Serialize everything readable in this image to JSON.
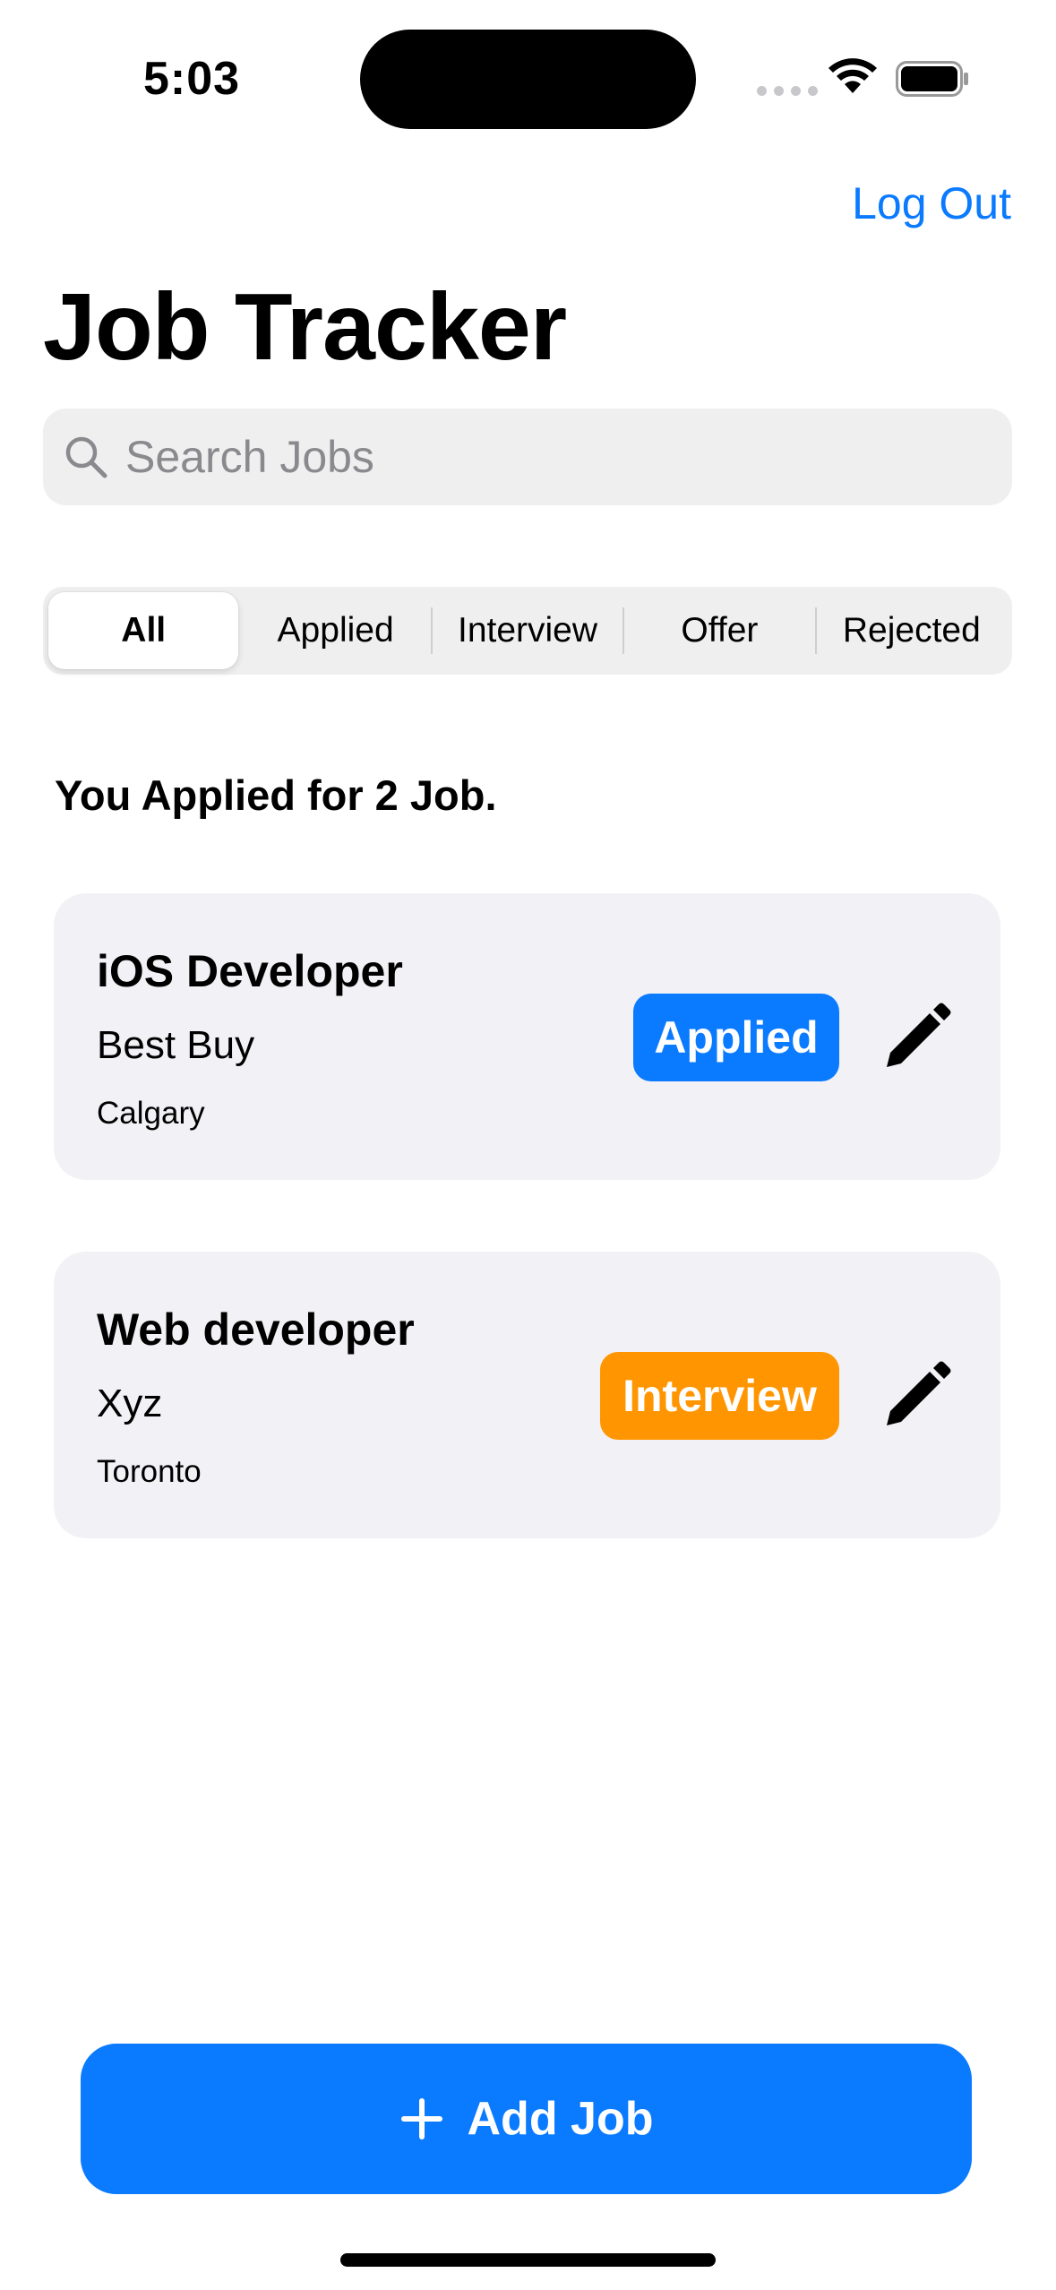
{
  "status_bar": {
    "time": "5:03"
  },
  "nav": {
    "logout_label": "Log Out",
    "title": "Job Tracker"
  },
  "search": {
    "placeholder": "Search Jobs",
    "value": ""
  },
  "filters": {
    "selected": "All",
    "segments": [
      "All",
      "Applied",
      "Interview",
      "Offer",
      "Rejected"
    ]
  },
  "summary": "You Applied for 2 Job.",
  "jobs": [
    {
      "title": "iOS Developer",
      "company": "Best Buy",
      "location": "Calgary",
      "status": "Applied",
      "status_color": "#0A7AFF"
    },
    {
      "title": "Web developer",
      "company": "Xyz",
      "location": "Toronto",
      "status": "Interview",
      "status_color": "#FF9500"
    }
  ],
  "add_button": {
    "label": "Add Job",
    "icon": "plus-icon"
  },
  "colors": {
    "accent": "#0A7AFF",
    "interview": "#FF9500",
    "card_bg": "#F2F2F6",
    "field_bg": "#EFEFF0"
  }
}
